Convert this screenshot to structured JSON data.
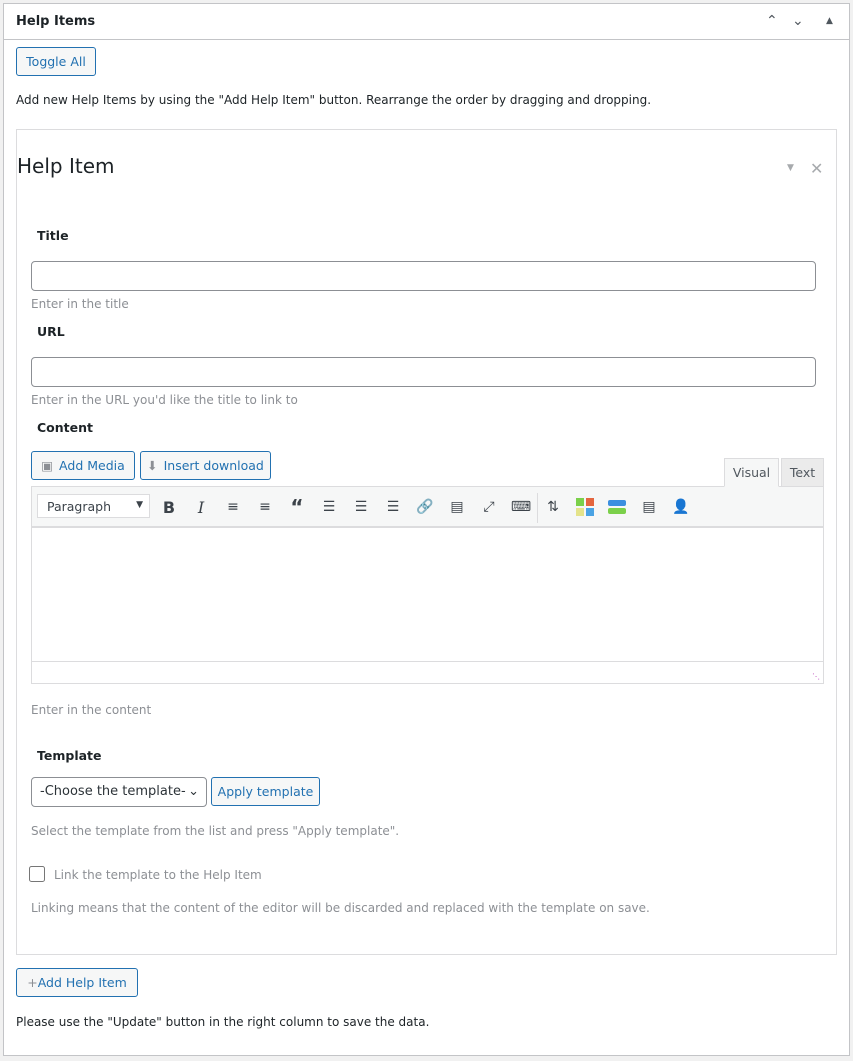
{
  "panel": {
    "title": "Help Items",
    "toggle_all": "Toggle All",
    "intro": "Add new Help Items by using the \"Add Help Item\" button. Rearrange the order by dragging and dropping.",
    "add_item": "Add Help Item",
    "footer": "Please use the \"Update\" button in the right column to save the data."
  },
  "item": {
    "heading": "Help Item",
    "title_label": "Title",
    "title_value": "",
    "title_desc": "Enter in the title",
    "url_label": "URL",
    "url_value": "",
    "url_desc": "Enter in the URL you'd like the title to link to",
    "content_label": "Content",
    "add_media": "Add Media",
    "insert_download": "Insert download",
    "tab_visual": "Visual",
    "tab_text": "Text",
    "format_select": "Paragraph",
    "content_desc": "Enter in the content",
    "template_label": "Template",
    "template_select": "-Choose the template-",
    "apply_template": "Apply template",
    "template_desc": "Select the template from the list and press \"Apply template\".",
    "link_label": "Link the template to the Help Item",
    "link_checked": false,
    "link_desc": "Linking means that the content of the editor will be discarded and replaced with the template on save."
  },
  "colors": {
    "accent": "#2271b1"
  }
}
